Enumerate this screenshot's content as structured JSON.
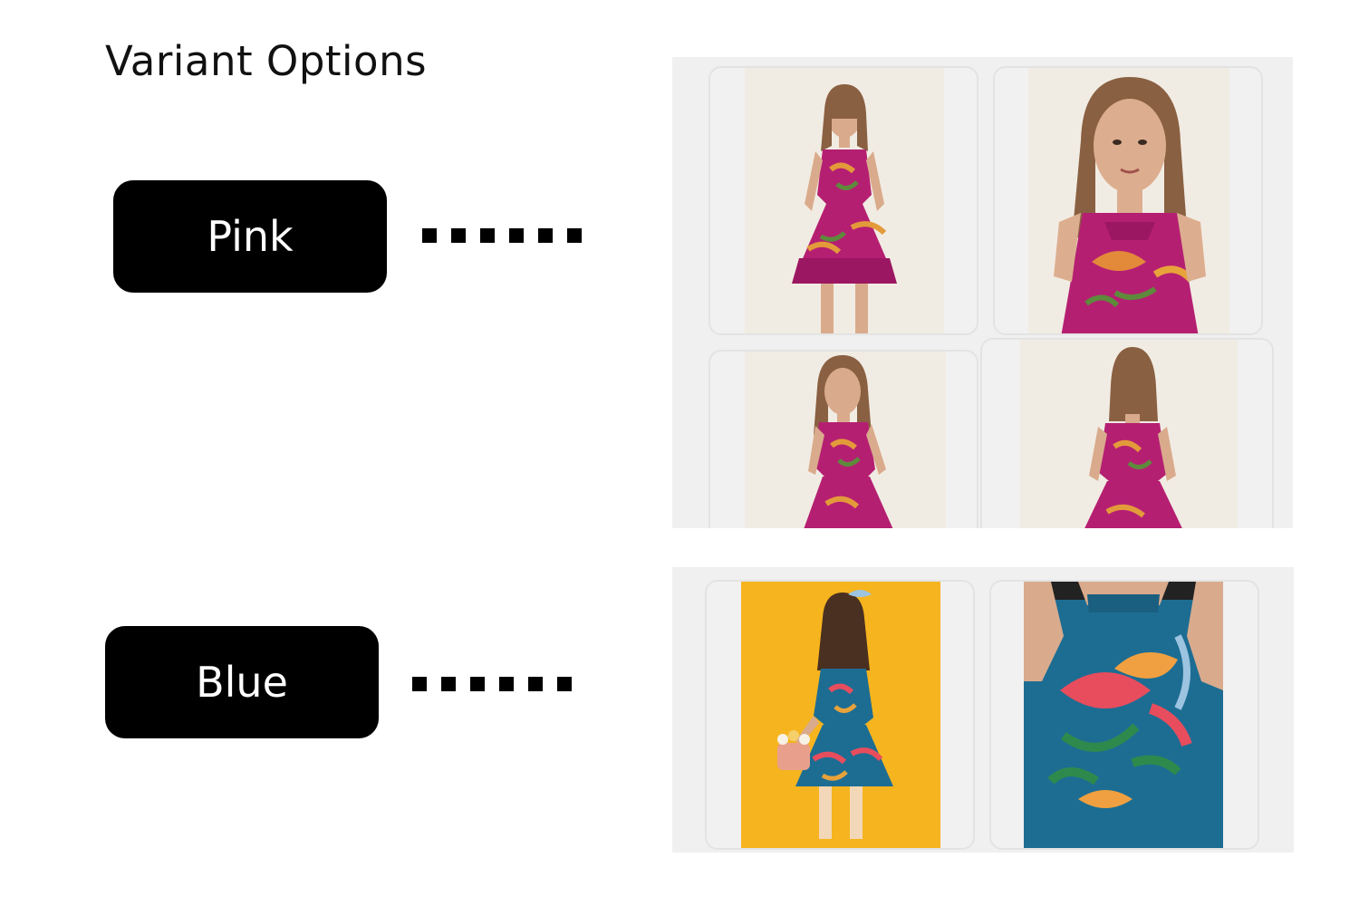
{
  "page": {
    "title": "Variant Options"
  },
  "variants": [
    {
      "label": "Pink",
      "color": "#b51f72",
      "photos": [
        "front-full",
        "front-closeup",
        "side-view",
        "back-view"
      ]
    },
    {
      "label": "Blue",
      "color": "#1d6d93",
      "photos": [
        "back-view-yellow-backdrop",
        "neckline-closeup"
      ]
    }
  ],
  "colors": {
    "button_bg": "#000000",
    "button_text": "#ffffff",
    "gallery_bg": "#f0f0f0",
    "photo_bg_cream": "#f1ece3",
    "photo_bg_yellow": "#f6b41f",
    "pink_dress": "#b51f72",
    "blue_dress": "#1d6d93"
  },
  "icons": {
    "connector": "dotted-line-icon"
  }
}
